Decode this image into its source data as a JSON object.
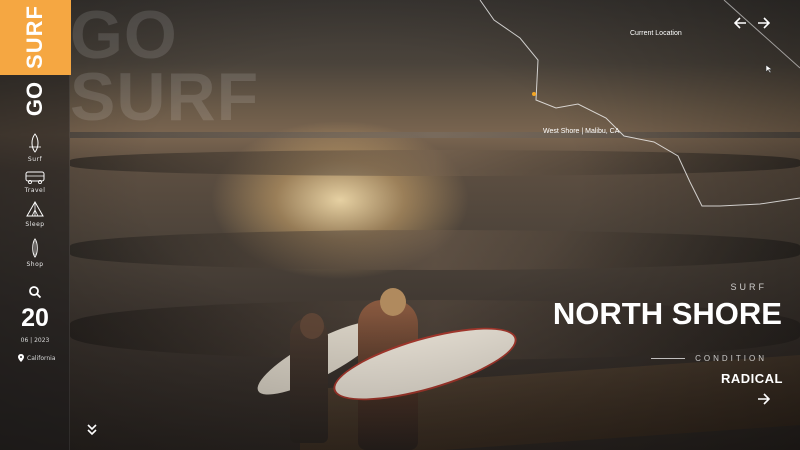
{
  "brand": {
    "top": "SURF",
    "bottom": "GO"
  },
  "ghost_text": {
    "line1": "GO",
    "line2": "SURF"
  },
  "colors": {
    "accent": "#f5a742",
    "location_dot": "#f5a623"
  },
  "sidebar": {
    "items": [
      {
        "label": "Surf",
        "icon": "surfboard-icon"
      },
      {
        "label": "Travel",
        "icon": "van-icon"
      },
      {
        "label": "Sleep",
        "icon": "tent-icon"
      },
      {
        "label": "Shop",
        "icon": "board-shop-icon"
      }
    ],
    "search_icon": "search-icon",
    "date": {
      "day": "20",
      "month_year": "06 | 2023"
    },
    "location": "California",
    "scroll_icon": "chevron-double-down-icon"
  },
  "map": {
    "current_location": "Current Location",
    "spot_label": "West Shore | Malibu, CA"
  },
  "hero": {
    "kicker": "SURF",
    "title": "NORTH SHORE",
    "condition_label": "CONDITION",
    "condition_value": "RADICAL"
  }
}
